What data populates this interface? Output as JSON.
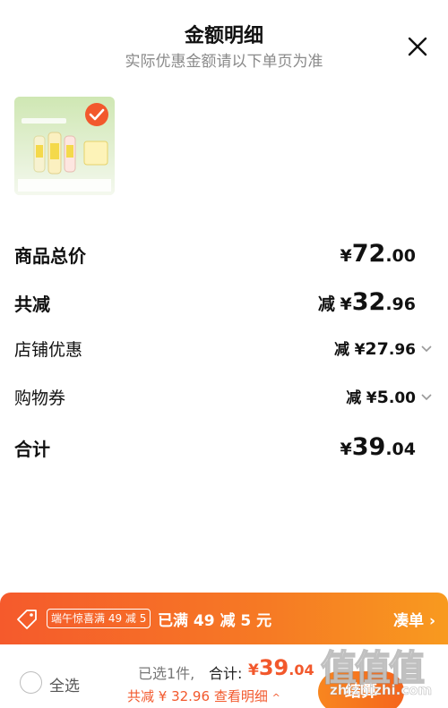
{
  "header": {
    "title": "金额明细",
    "subtitle": "实际优惠金额请以下单页为准"
  },
  "product": {
    "thumbnail_icon": "product-thumbnail",
    "selected": true
  },
  "breakdown": {
    "subtotal_label": "商品总价",
    "subtotal_currency": "¥",
    "subtotal_int": "72",
    "subtotal_dec": ".00",
    "reduction_label": "共减",
    "reduction_prefix": "减",
    "reduction_currency": "¥",
    "reduction_int": "32",
    "reduction_dec": ".96",
    "store_discount_label": "店铺优惠",
    "store_discount_prefix": "减",
    "store_discount_currency": "¥",
    "store_discount_int": "27",
    "store_discount_dec": ".96",
    "coupon_label": "购物券",
    "coupon_prefix": "减",
    "coupon_currency": "¥",
    "coupon_int": "5",
    "coupon_dec": ".00",
    "total_label": "合计",
    "total_currency": "¥",
    "total_int": "39",
    "total_dec": ".04"
  },
  "promo": {
    "chip_text": "端午惊喜满 49 减 5",
    "status_text": "已满 49 减 5 元",
    "action_text": "凑单"
  },
  "footer": {
    "select_all_label": "全选",
    "selected_count": "已选1件,",
    "total_label": "合计:",
    "total_currency": "¥",
    "total_int": "39",
    "total_dec": ".04",
    "discount_prefix": "共减 ¥ 32.96",
    "view_details": "查看明细",
    "checkout_label": "结算"
  },
  "watermark": {
    "url": "zhizhizhi.com"
  },
  "colors": {
    "accent": "#f2582c",
    "promo_gradient_start": "#f55a2c",
    "promo_gradient_end": "#f89a1f"
  }
}
